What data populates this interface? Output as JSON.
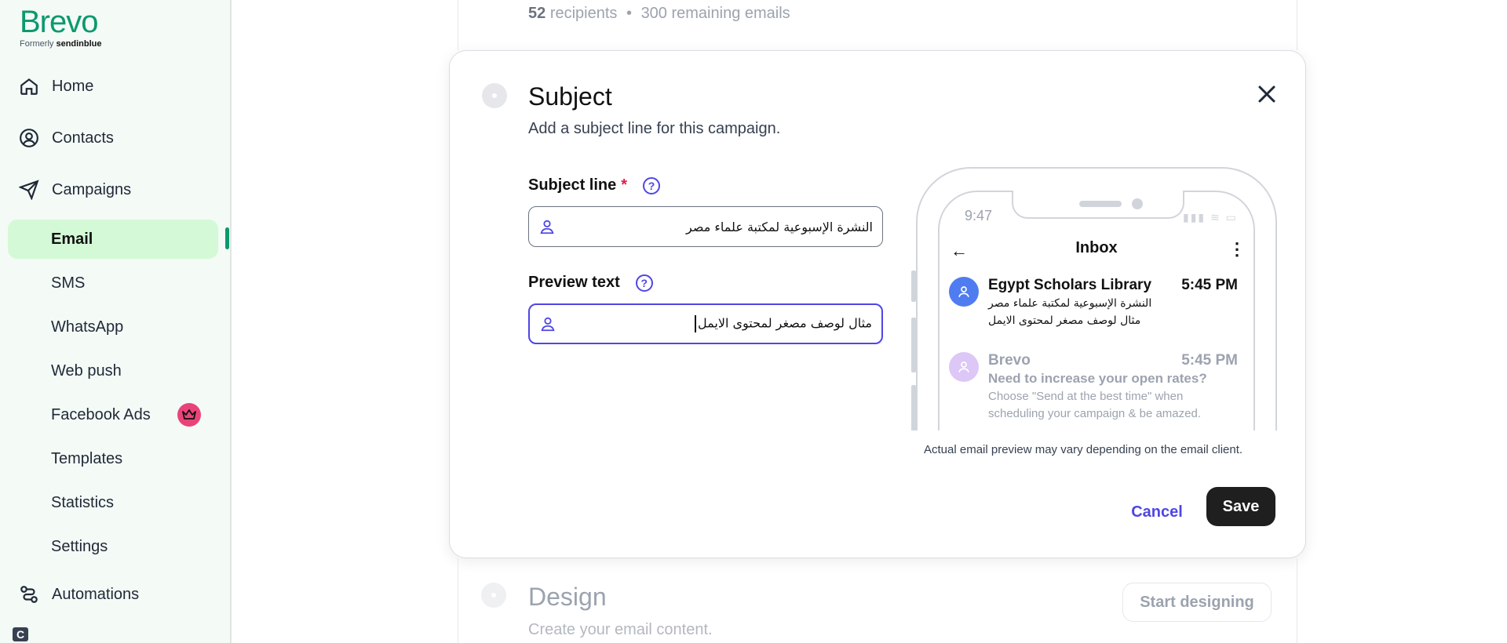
{
  "brand": {
    "name": "Brevo",
    "formerly": "Formerly",
    "formerly_brand": "sendinblue",
    "color": "#0b996e"
  },
  "sidebar": {
    "main": [
      {
        "label": "Home",
        "icon": "home-icon"
      },
      {
        "label": "Contacts",
        "icon": "contacts-icon"
      },
      {
        "label": "Campaigns",
        "icon": "send-icon"
      },
      {
        "label": "Automations",
        "icon": "automation-icon"
      }
    ],
    "campaign_items": [
      {
        "label": "Email",
        "active": true
      },
      {
        "label": "SMS"
      },
      {
        "label": "WhatsApp"
      },
      {
        "label": "Web push"
      },
      {
        "label": "Facebook Ads",
        "badge": "crown-icon"
      },
      {
        "label": "Templates"
      },
      {
        "label": "Statistics"
      },
      {
        "label": "Settings"
      }
    ]
  },
  "recipients": {
    "count": "52",
    "count_label": "recipients",
    "separator": "•",
    "remaining": "300 remaining emails"
  },
  "subject_card": {
    "title": "Subject",
    "description": "Add a subject line for this campaign.",
    "subject_label": "Subject line",
    "required_mark": "*",
    "subject_value": "النشرة الإسبوعية لمكتبة علماء مصر",
    "preview_label": "Preview text",
    "preview_value": "مثال لوصف مصغر لمحتوى الايمل",
    "help_glyph": "?",
    "cancel_label": "Cancel",
    "save_label": "Save",
    "preview_note": "Actual email preview may vary depending on the email client."
  },
  "phone": {
    "time": "9:47",
    "inbox_title": "Inbox",
    "back_glyph": "←",
    "kebab_glyph": "⋮",
    "signal_glyph": "▮▮▮ ≋ ▭",
    "emails": [
      {
        "from": "Egypt Scholars Library",
        "time": "5:45 PM",
        "subject": "النشرة الإسبوعية لمكتبة علماء مصر",
        "preview": "مثال لوصف مصغر لمحتوى الايمل"
      },
      {
        "from": "Brevo",
        "time": "5:45 PM",
        "subject": "Need to increase your open rates?",
        "preview": "Choose \"Send at the best time\" when",
        "preview2": "scheduling your campaign & be amazed."
      }
    ]
  },
  "design_section": {
    "title": "Design",
    "description": "Create your email content.",
    "button": "Start designing"
  },
  "chat_glyph": "C"
}
